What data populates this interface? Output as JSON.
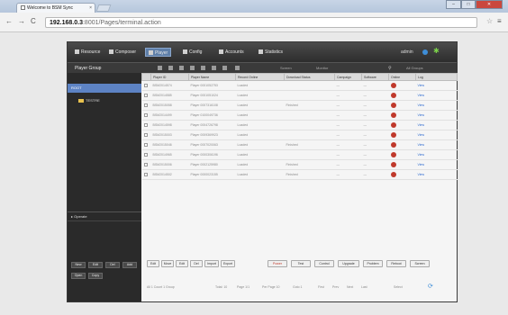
{
  "browser": {
    "tab_title": "Welcome to BSM Sync",
    "tab_close": "×",
    "url_host": "192.168.0.3",
    "url_path": ":8001/Pages/terminal.action",
    "back": "←",
    "forward": "→",
    "reload": "C",
    "star": "☆",
    "menu": "≡",
    "win_min": "–",
    "win_max": "□",
    "win_close": "✕"
  },
  "nav": {
    "items": [
      "Resource",
      "Composer",
      "Player",
      "Config",
      "Accounts",
      "Statistics"
    ],
    "active_index": 2,
    "admin": "admin"
  },
  "toolbar": {
    "group_title": "Player Group",
    "label_a": "Screen",
    "label_b": "Monitor",
    "search_hint": "All Groups"
  },
  "sidebar": {
    "selected": "ROOT",
    "folder": "TESTRE",
    "schedule": "Operate",
    "buttons": [
      "New",
      "Edit",
      "Del",
      "Add",
      "Open",
      "Copy"
    ]
  },
  "table": {
    "headers": [
      "",
      "Player ID",
      "Player Name",
      "Record Online",
      "Download Status",
      "Campaign",
      "Software",
      "Online",
      "Log"
    ],
    "rows": [
      [
        "BSM2014574",
        "Player 0001052753",
        "Loaded",
        "",
        "—",
        "—",
        "View"
      ],
      [
        "BSM2014585",
        "Player 0001051024",
        "Loaded",
        "",
        "—",
        "—",
        "View"
      ],
      [
        "BSM2015058",
        "Player 0007316108",
        "Loaded",
        "Finished",
        "—",
        "—",
        "View"
      ],
      [
        "BSM2014499",
        "Player 0100049736",
        "Loaded",
        "",
        "—",
        "—",
        "View"
      ],
      [
        "BSM2014598",
        "Player 0004726798",
        "Loaded",
        "",
        "—",
        "—",
        "View"
      ],
      [
        "BSM2015003",
        "Player 0009369923",
        "Loaded",
        "",
        "—",
        "—",
        "View"
      ],
      [
        "BSM2015046",
        "Player 0007020063",
        "Loaded",
        "Finished",
        "—",
        "—",
        "View"
      ],
      [
        "BSM2014965",
        "Player 0000306196",
        "Loaded",
        "",
        "—",
        "—",
        "View"
      ],
      [
        "BSM2015006",
        "Player 0002125980",
        "Loaded",
        "Finished",
        "—",
        "—",
        "View"
      ],
      [
        "BSM2014502",
        "Player 0000023155",
        "Loaded",
        "Finished",
        "—",
        "—",
        "View"
      ]
    ]
  },
  "actions": {
    "left": [
      "Edit",
      "Move",
      "Edit",
      "Del",
      "Import",
      "Export"
    ],
    "right": [
      "Power",
      "Test",
      "Control",
      "Upgrade",
      "Problem",
      "Reboot",
      "Screen"
    ]
  },
  "pager": {
    "info": "All 1 Count 1 Group",
    "total": "Total: 10",
    "page": "Page 1/1",
    "per_page": "Per Page 10",
    "goto": "Goto 1",
    "first": "First",
    "prev": "Prev",
    "next": "Next",
    "last": "Last",
    "select": "Select"
  }
}
